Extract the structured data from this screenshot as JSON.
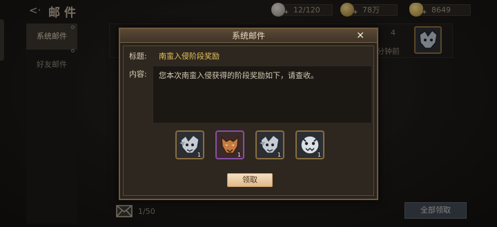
{
  "header": {
    "back_icon": "back-arrow-icon",
    "title": "邮件",
    "resources": [
      {
        "icon": "silver-coin-icon",
        "value": "12/120"
      },
      {
        "icon": "gold-coin-icon",
        "value": "78万"
      },
      {
        "icon": "gold-ingot-icon",
        "value": "8649"
      }
    ]
  },
  "sidebar": {
    "tabs": [
      {
        "label": "系统邮件",
        "active": true
      },
      {
        "label": "好友邮件",
        "active": false
      }
    ]
  },
  "list": {
    "item": {
      "count": "4",
      "time": "分钟前"
    }
  },
  "footer": {
    "mail_count": "1/50",
    "claim_all": "全部领取"
  },
  "dialog": {
    "title": "系统邮件",
    "close_icon": "close-icon",
    "subject_label": "标题:",
    "subject": "南蛮入侵阶段奖励",
    "content_label": "内容:",
    "content": "您本次南蛮入侵获得的阶段奖励如下，请查收。",
    "rewards": [
      {
        "icon": "silver-wolf-mask-icon",
        "quality": "gold",
        "qty": "1"
      },
      {
        "icon": "bronze-beast-mask-icon",
        "quality": "purple",
        "qty": "1"
      },
      {
        "icon": "silver-wolf-mask-icon",
        "quality": "gold",
        "qty": "1"
      },
      {
        "icon": "silver-tiger-mask-icon",
        "quality": "gold",
        "qty": "1"
      }
    ],
    "claim_label": "领取"
  },
  "colors": {
    "accent_gold": "#e9c45c",
    "claim_button": "#f6dfc0",
    "frame": "#6f5a3c"
  }
}
